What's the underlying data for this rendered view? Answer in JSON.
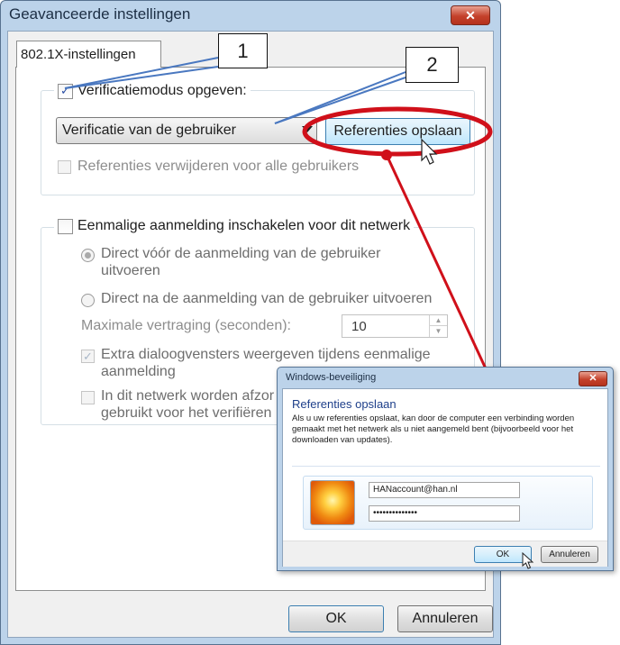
{
  "main_window": {
    "title": "Geavanceerde instellingen",
    "close_glyph": "✕",
    "tab_label": "802.1X-instellingen",
    "verification": {
      "checkbox_label": "Verificatiemodus opgeven:",
      "checked": true,
      "mode_selected": "Verificatie van de gebruiker",
      "save_credentials_button": "Referenties opslaan",
      "delete_credentials_label": "Referenties verwijderen voor alle gebruikers"
    },
    "sso": {
      "checkbox_label": "Eenmalige aanmelding inschakelen voor dit netwerk",
      "radio_before_line1": "Direct vóór de aanmelding van de gebruiker",
      "radio_before_line2": "uitvoeren",
      "radio_after": "Direct na de aanmelding van de gebruiker uitvoeren",
      "max_delay_label": "Maximale vertraging (seconden):",
      "max_delay_value": "10",
      "extra_dialogs_line1": "Extra dialoogvensters weergeven tijdens eenmalige",
      "extra_dialogs_line2": "aanmelding",
      "separate_accounts_line1": "In dit netwerk worden afzor",
      "separate_accounts_line2": "gebruikt voor het verifiëren"
    },
    "ok_button": "OK",
    "cancel_button": "Annuleren"
  },
  "callouts": [
    "1",
    "2"
  ],
  "dialog": {
    "title": "Windows-beveiliging",
    "close_glyph": "✕",
    "heading": "Referenties opslaan",
    "description": "Als u uw referenties opslaat, kan door de computer een verbinding worden gemaakt met het netwerk als u niet aangemeld bent (bijvoorbeeld voor het downloaden van updates).",
    "username": "HANaccount@han.nl",
    "password_masked": "••••••••••••••",
    "ok_button": "OK",
    "cancel_button": "Annuleren"
  },
  "colors": {
    "highlight_red": "#d0101a",
    "callout_line": "#4a78c0",
    "title_bar": "#bcd3ea"
  },
  "icons": [
    "close-icon",
    "checkbox-checked-icon",
    "dropdown-arrow-icon",
    "spin-up-icon",
    "spin-down-icon",
    "mouse-cursor-icon",
    "user-avatar-icon"
  ]
}
